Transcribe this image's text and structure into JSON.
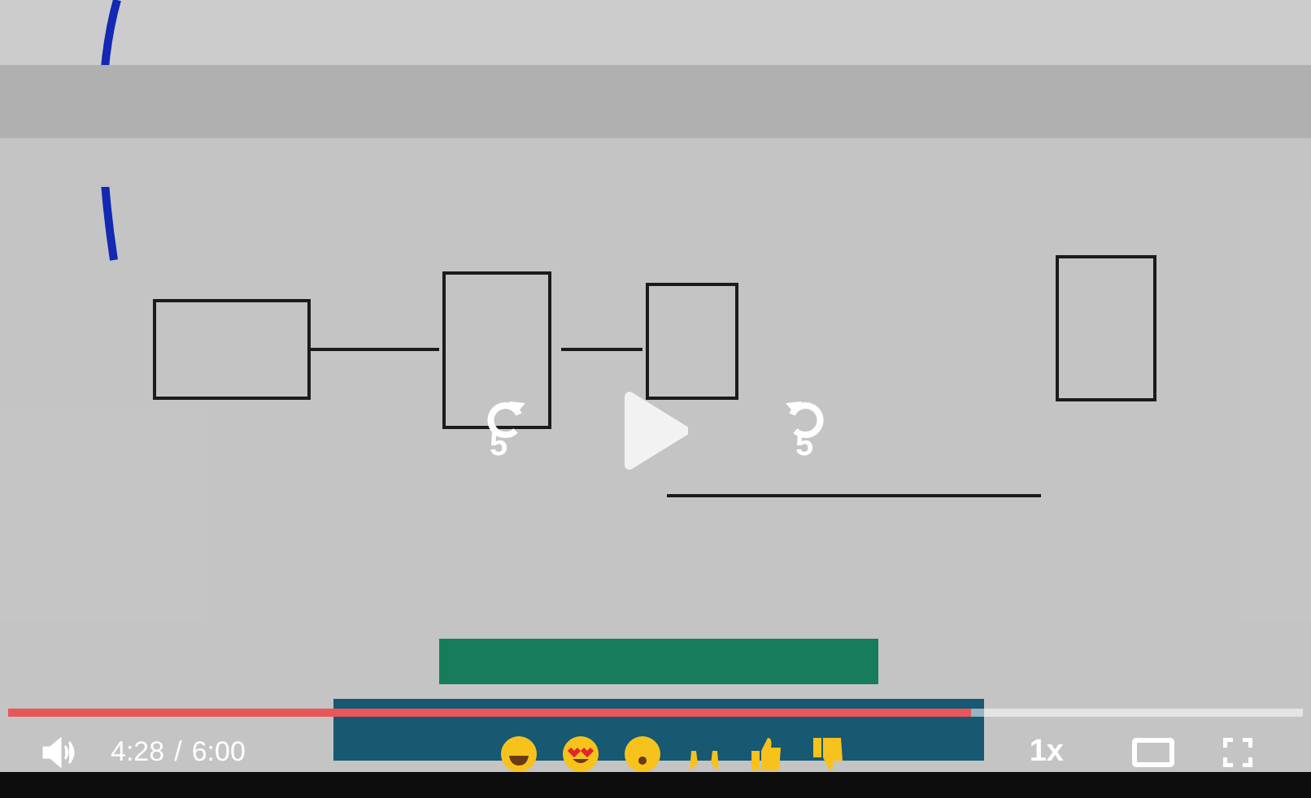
{
  "player": {
    "elapsed": "4:28",
    "separator": "/",
    "duration": "6:00",
    "speed": "1x",
    "progress": {
      "level": 0.744
    },
    "skip_back": "5",
    "skip_forward": "5",
    "paused": true
  }
}
